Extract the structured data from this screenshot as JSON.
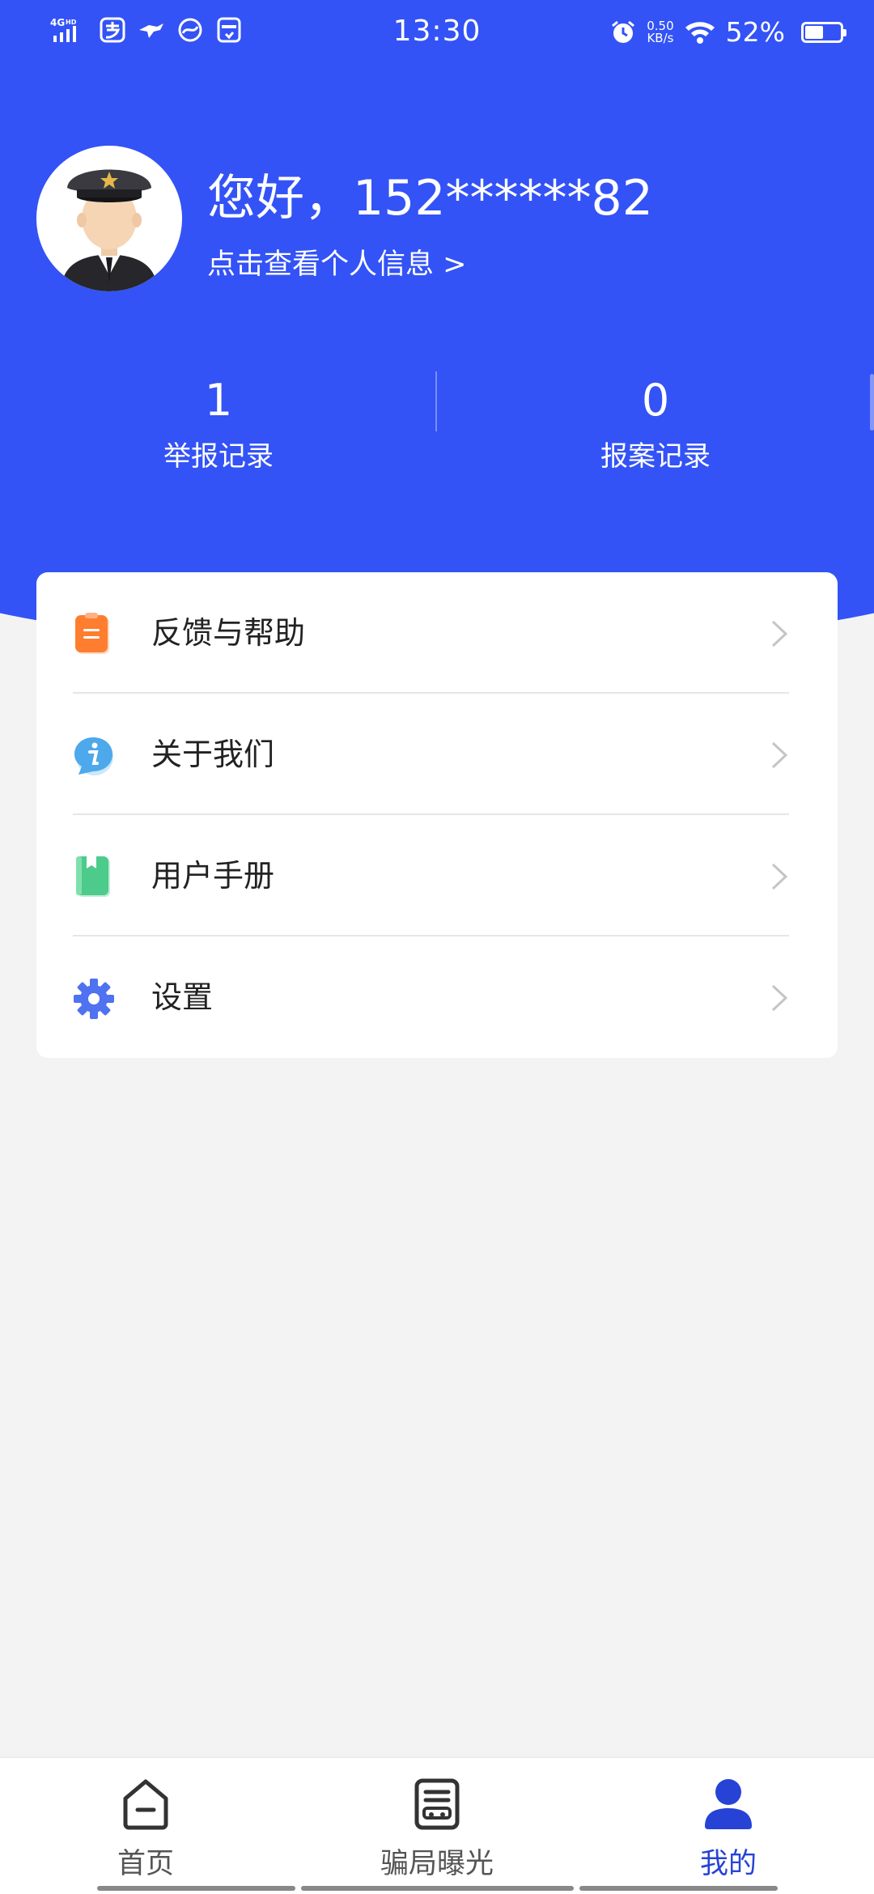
{
  "status_bar": {
    "network": "4GHD",
    "time": "13:30",
    "speed_value": "0.50",
    "speed_unit": "KB/s",
    "battery_text": "52%",
    "battery_level": 0.52
  },
  "profile": {
    "greeting": "您好，152******82",
    "view_info_link": "点击查看个人信息 >"
  },
  "stats": [
    {
      "value": "1",
      "label": "举报记录"
    },
    {
      "value": "0",
      "label": "报案记录"
    }
  ],
  "menu": {
    "items": [
      {
        "label": "反馈与帮助",
        "icon": "clipboard-icon"
      },
      {
        "label": "关于我们",
        "icon": "info-icon"
      },
      {
        "label": "用户手册",
        "icon": "book-icon"
      },
      {
        "label": "设置",
        "icon": "gear-icon"
      }
    ]
  },
  "bottom_nav": {
    "items": [
      {
        "label": "首页",
        "icon": "home-icon",
        "active": false
      },
      {
        "label": "骗局曝光",
        "icon": "exposure-icon",
        "active": false
      },
      {
        "label": "我的",
        "icon": "user-icon",
        "active": true
      }
    ]
  },
  "colors": {
    "primary": "#3353f6",
    "active_nav": "#2743d6",
    "background": "#f3f3f4"
  }
}
